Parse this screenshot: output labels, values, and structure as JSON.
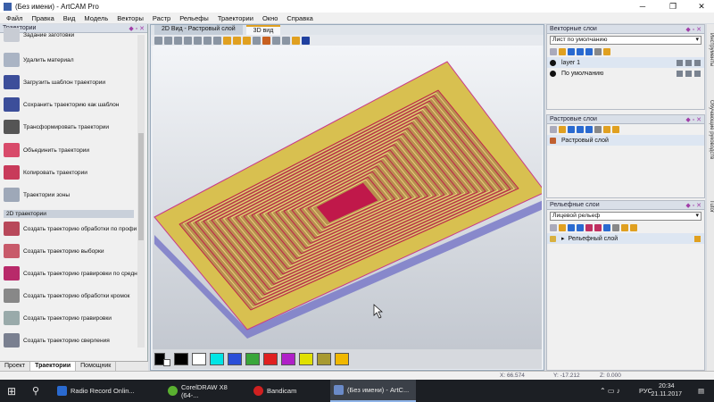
{
  "window": {
    "title": "(Без имени) - ArtCAM Pro",
    "minimize": "─",
    "maximize": "❐",
    "close": "✕"
  },
  "menu": [
    "Файл",
    "Правка",
    "Вид",
    "Модель",
    "Векторы",
    "Растр",
    "Рельефы",
    "Траектории",
    "Окно",
    "Справка"
  ],
  "left_panel": {
    "title": "Траектории",
    "tools": [
      "Задание заготовки",
      "Удалить материал",
      "Загрузить шаблон траектории",
      "Сохранить траекторию как шаблон",
      "Трансформировать траектории",
      "Объединить траектории",
      "Копировать траектории",
      "Траектории зоны"
    ],
    "section_2d": "2D траектории",
    "tools_2d": [
      "Создать траекторию обработки по профи",
      "Создать траекторию выборки",
      "Создать траекторию гравировки по средн",
      "Создать траекторию обработки кромок",
      "Создать траекторию гравировки",
      "Создать траекторию сверления"
    ],
    "tabs": [
      "Проект",
      "Траектории",
      "Помощник"
    ]
  },
  "center": {
    "tabs": [
      "2D Вид - Растровый слой",
      "3D вид"
    ],
    "palette_colors": [
      "#000000",
      "#ffffff",
      "#00e5e5",
      "#2b4fd8",
      "#3aa63a",
      "#e02020",
      "#b020c8",
      "#e0e000",
      "#a89a30",
      "#f0b800"
    ]
  },
  "vector_layers": {
    "title": "Векторные слои",
    "dropdown": "Лист по умолчанию",
    "rows": [
      "layer 1",
      "По умолчанию"
    ]
  },
  "raster_layers": {
    "title": "Растровые слои",
    "rows": [
      "Растровый слой"
    ]
  },
  "relief_layers": {
    "title": "Рельефные слои",
    "dropdown": "Лицевой рельеф",
    "rows": [
      "Рельефный слой"
    ]
  },
  "side_tabs": [
    "Инструменты",
    "Обучающие руководств",
    "Tutor"
  ],
  "status": {
    "x": "X: 66.574",
    "y": "Y: -17.212",
    "z": "Z: 0.000"
  },
  "taskbar": {
    "items": [
      "Radio Record Onlin...",
      "CorelDRAW X8 (64-...",
      "Bandicam",
      "(Без имени) - ArtC..."
    ],
    "lang": "РУС",
    "time": "20:34",
    "date": "21.11.2017"
  },
  "colors": {
    "accent": "#c8a040",
    "toolpath": "#c0184a"
  }
}
